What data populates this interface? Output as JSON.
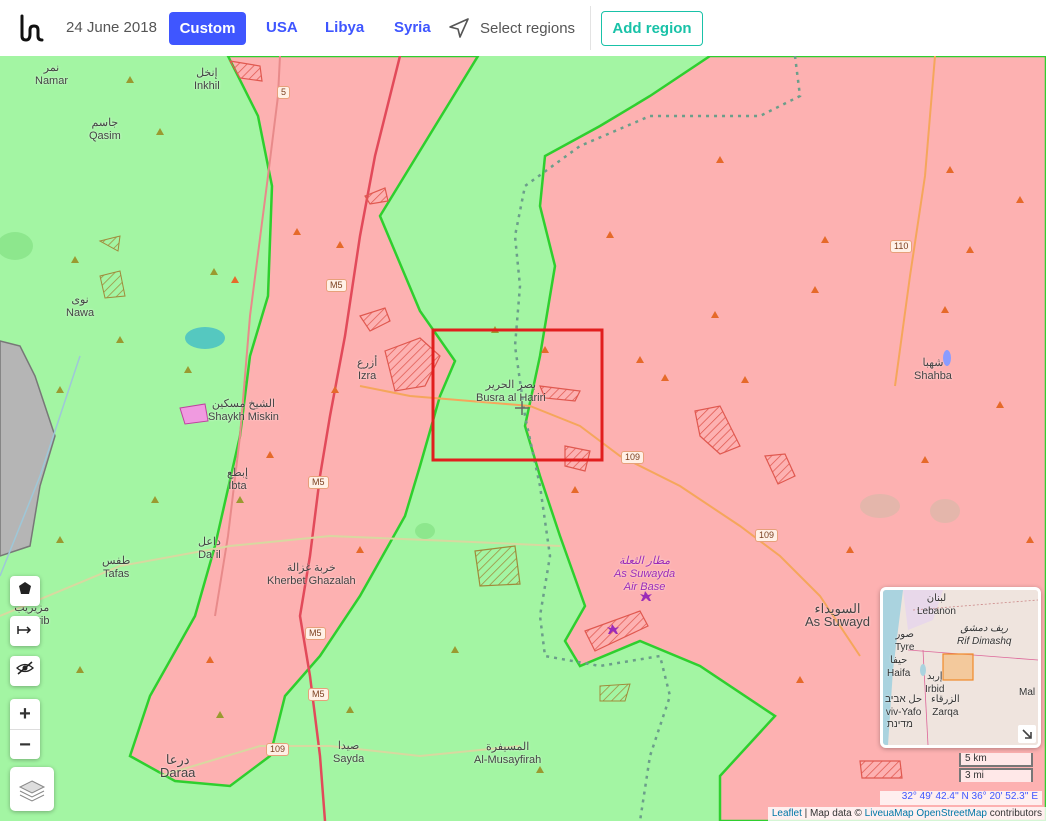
{
  "header": {
    "date": "24 June 2018",
    "custom_label": "Custom",
    "nav": [
      "USA",
      "Libya",
      "Syria"
    ],
    "select_regions_label": "Select regions",
    "add_region_label": "Add region"
  },
  "map": {
    "colors": {
      "rebel": "#a3f5a3",
      "government": "#fdb1b1",
      "isis": "#b0b0b0",
      "selection": "#e11e1e",
      "road": "#f5a65b"
    },
    "places": [
      {
        "ar": "نمر",
        "en": "Namar"
      },
      {
        "ar": "إنخل",
        "en": "Inkhil"
      },
      {
        "ar": "جاسم",
        "en": "Qasim"
      },
      {
        "ar": "نوى",
        "en": "Nawa"
      },
      {
        "ar": "أزرع",
        "en": "Izra"
      },
      {
        "ar": "الشيخ مسكين",
        "en": "Shaykh Miskin"
      },
      {
        "ar": "إبطع",
        "en": "Ibta"
      },
      {
        "ar": "داعل",
        "en": "Da`il"
      },
      {
        "ar": "طفس",
        "en": "Tafas"
      },
      {
        "ar": "مزيريب",
        "en": "uzayrib"
      },
      {
        "ar": "خربة غزالة",
        "en": "Kherbet Ghazalah"
      },
      {
        "ar": "درعا",
        "en": "Daraa"
      },
      {
        "ar": "صيدا",
        "en": "Sayda"
      },
      {
        "ar": "المسيفرة",
        "en": "Al-Musayfirah"
      },
      {
        "ar": "بصر الحرير",
        "en": "Busra al Hariri"
      },
      {
        "ar": "شهبا",
        "en": "Shahba"
      },
      {
        "ar": "السويداء",
        "en": "As Suwayd"
      }
    ],
    "airbase": {
      "ar": "مطار الثعلة",
      "en1": "As Suwayda",
      "en2": "Air Base"
    },
    "road_shields": [
      "5",
      "M5",
      "M5",
      "M5",
      "M5",
      "109",
      "109",
      "109",
      "110"
    ]
  },
  "controls": {
    "zoom_in": "+",
    "zoom_out": "−",
    "polygon_icon": "polygon-icon",
    "line_icon": "arrow-line-icon",
    "hide_icon": "eye-slash-icon",
    "layers_icon": "layers-icon"
  },
  "minimap": {
    "labels": [
      "لبنان",
      "Lebanon",
      "ريف دمشق",
      "Rif Dimashq",
      "صور",
      "Tyre",
      "حيفا",
      "Haifa",
      "إربد",
      "Irbid",
      "حل אביב",
      "viv-Yafo",
      "الزرقاء",
      "Zarqa",
      "Mal",
      "מדינת"
    ]
  },
  "scale": {
    "km": "5 km",
    "mi": "3 mi"
  },
  "coordinates": "32° 49' 42.4'' N 36° 20' 52.3'' E",
  "attribution": {
    "leaflet": "Leaflet",
    "sep": " | Map data © ",
    "liveua": "LiveuaMap",
    "osm": "OpenStreetMap",
    "contrib": " contributors"
  }
}
